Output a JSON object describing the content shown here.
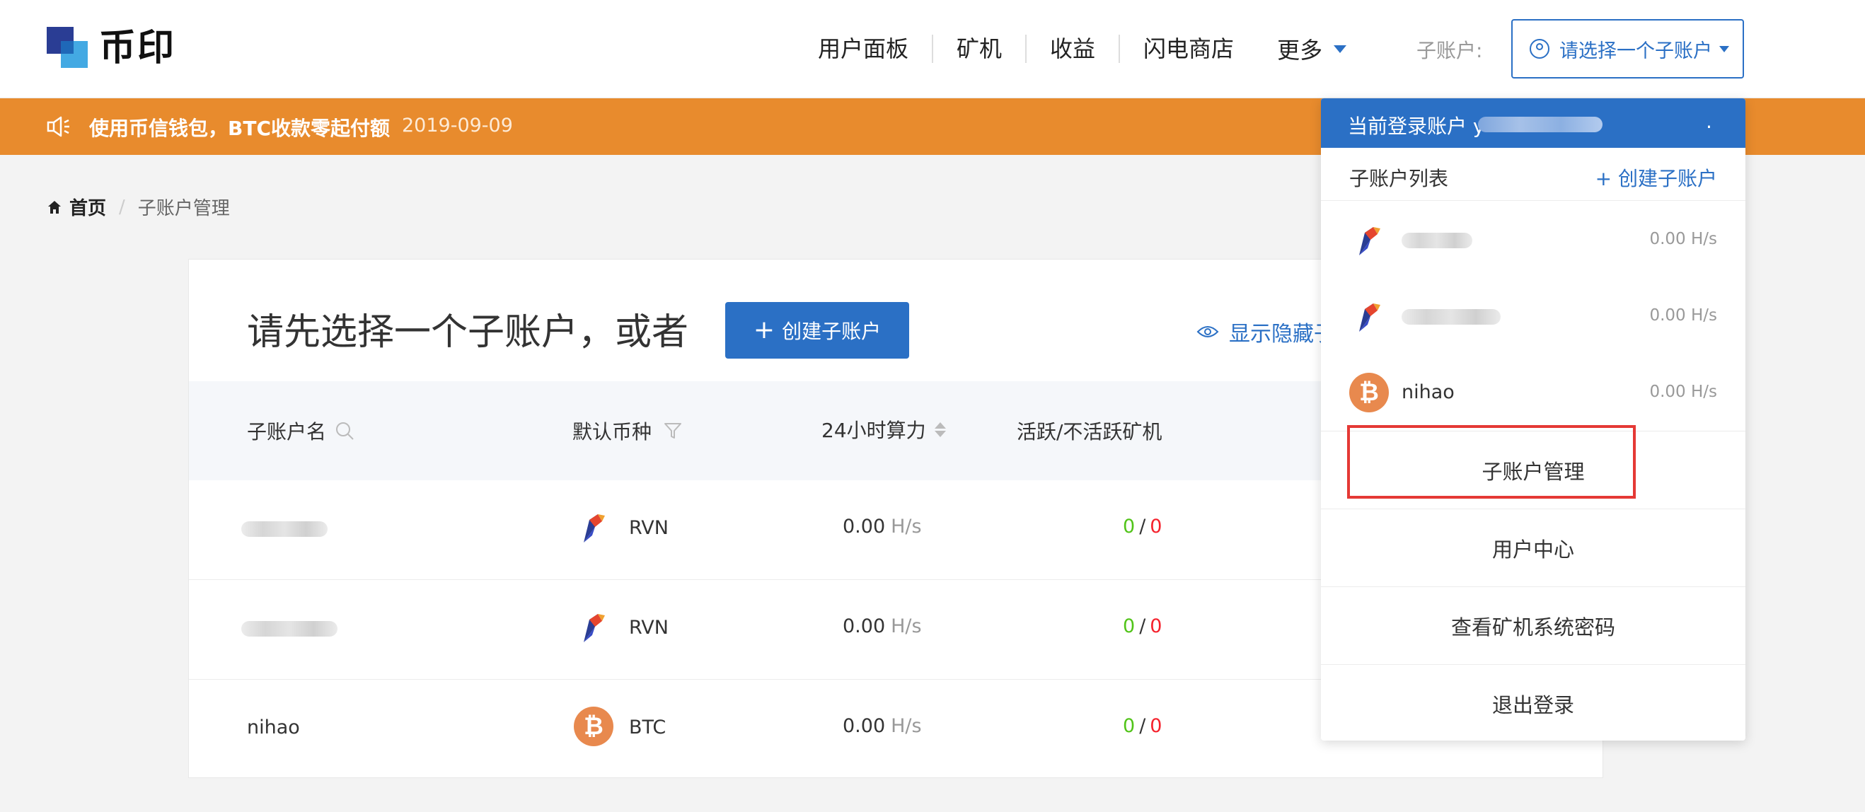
{
  "brand": {
    "name": "币印"
  },
  "nav": {
    "items": [
      "用户面板",
      "矿机",
      "收益",
      "闪电商店"
    ],
    "more": "更多",
    "sub_account_label": "子账户:",
    "sub_account_select": "请选择一个子账户"
  },
  "banner": {
    "text": "使用币信钱包，BTC收款零起付额",
    "date": "2019-09-09"
  },
  "breadcrumb": {
    "home": "首页",
    "current": "子账户管理"
  },
  "main": {
    "title": "请先选择一个子账户，或者",
    "create_button": "创建子账户",
    "create_button_plus": "+",
    "show_hidden": "显示隐藏子",
    "columns": [
      "子账户名",
      "默认币种",
      "24小时算力",
      "活跃/不活跃矿机"
    ],
    "rows": [
      {
        "name": "",
        "coin": "RVN",
        "hashrate": "0.00",
        "unit": "H/s",
        "active": "0",
        "inactive": "0"
      },
      {
        "name": "",
        "coin": "RVN",
        "hashrate": "0.00",
        "unit": "H/s",
        "active": "0",
        "inactive": "0"
      },
      {
        "name": "nihao",
        "coin": "BTC",
        "hashrate": "0.00",
        "unit": "H/s",
        "active": "0",
        "inactive": "0"
      }
    ],
    "separator": "/"
  },
  "dropdown": {
    "current_login_label": "当前登录账户",
    "current_login_prefix": "y",
    "current_login_suffix": ".",
    "list_title": "子账户列表",
    "create_link": "+ 创建子账户",
    "accounts": [
      {
        "name": "",
        "coin": "RVN",
        "hashrate": "0.00 H/s"
      },
      {
        "name": "",
        "coin": "RVN",
        "hashrate": "0.00 H/s"
      },
      {
        "name": "nihao",
        "coin": "BTC",
        "hashrate": "0.00 H/s"
      }
    ],
    "menu": [
      "子账户管理",
      "用户中心",
      "查看矿机系统密码",
      "退出登录"
    ]
  },
  "colors": {
    "primary": "#2b70c5",
    "banner": "#e88b2d",
    "active": "#52c41a",
    "inactive": "#f5222d",
    "highlight": "#e53935"
  },
  "icons": [
    "logo",
    "user-icon",
    "caret-down-icon",
    "speaker-icon",
    "home-icon",
    "search-icon",
    "filter-icon",
    "sort-icon",
    "eye-icon",
    "ravencoin-icon",
    "bitcoin-icon"
  ]
}
